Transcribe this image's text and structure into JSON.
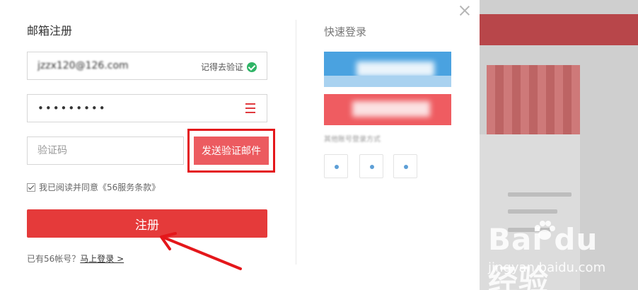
{
  "form": {
    "title": "邮箱注册",
    "email_value": "jzzx120@126.com",
    "remember_label": "记得去验证",
    "password_value": "•••••••••",
    "code_placeholder": "验证码",
    "send_button": "发送验证邮件",
    "agree_text": "我已阅读并同意《56服务条款》",
    "register_button": "注册",
    "login_prefix": "已有56帐号？",
    "login_link": "马上登录 >"
  },
  "quick_login": {
    "title": "快速登录",
    "note": "其他账号登录方式"
  },
  "watermark": {
    "brand": "Bai  du 经验",
    "url": "jingyan.baidu.com"
  },
  "colors": {
    "primary_red": "#e53a3a",
    "send_button": "#ec5b60",
    "highlight_box": "#e4171b",
    "check_green": "#2fb466",
    "quick_blue": "#4aa2e0",
    "quick_red": "#ef5c61"
  },
  "icons": {
    "close": "close-icon",
    "verified": "check-circle-icon",
    "password_toggle": "menu-icon",
    "agree": "checkbox-icon"
  }
}
